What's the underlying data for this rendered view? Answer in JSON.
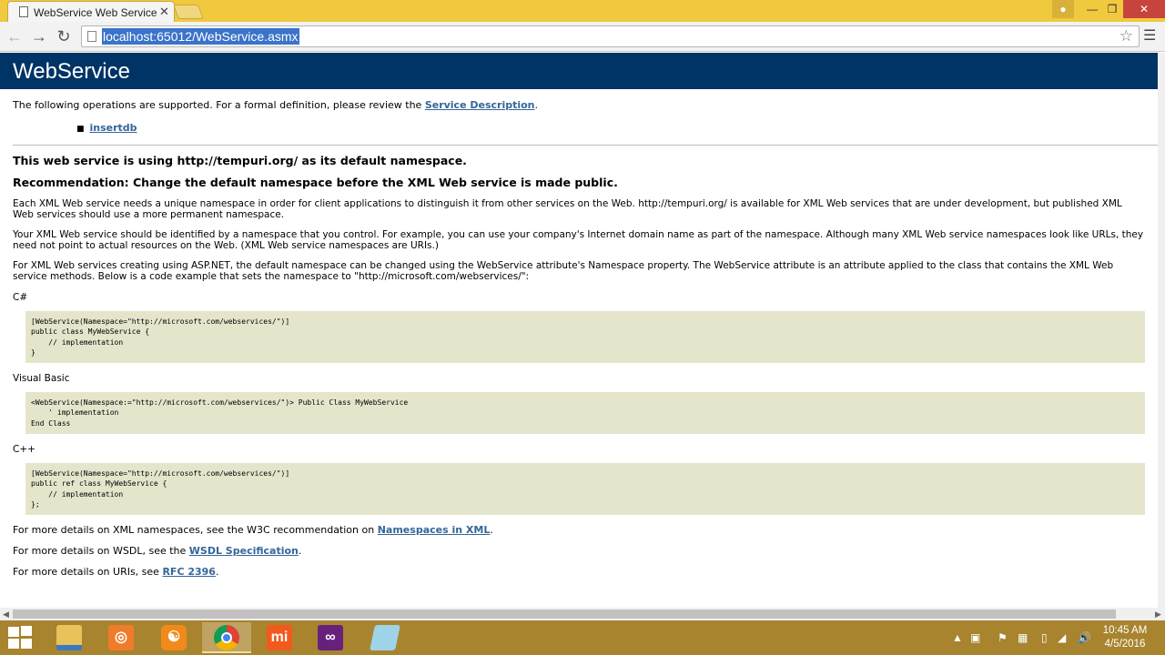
{
  "browser": {
    "tab_title": "WebService Web Service",
    "tab_close": "✕",
    "url": "localhost:65012/WebService.asmx",
    "window_controls": {
      "minimize": "—",
      "maximize": "❐",
      "close": "✕"
    }
  },
  "page": {
    "heading": "WebService",
    "intro_text": "The following operations are supported. For a formal definition, please review the ",
    "intro_link": "Service Description",
    "intro_end": ".",
    "operations": [
      "insertdb"
    ],
    "namespace_notice": "This web service is using http://tempuri.org/ as its default namespace.",
    "recommendation": "Recommendation: Change the default namespace before the XML Web service is made public.",
    "para1": "Each XML Web service needs a unique namespace in order for client applications to distinguish it from other services on the Web. http://tempuri.org/ is available for XML Web services that are under development, but published XML Web services should use a more permanent namespace.",
    "para2": "Your XML Web service should be identified by a namespace that you control. For example, you can use your company's Internet domain name as part of the namespace. Although many XML Web service namespaces look like URLs, they need not point to actual resources on the Web. (XML Web service namespaces are URIs.)",
    "para3": "For XML Web services creating using ASP.NET, the default namespace can be changed using the WebService attribute's Namespace property. The WebService attribute is an attribute applied to the class that contains the XML Web service methods. Below is a code example that sets the namespace to \"http://microsoft.com/webservices/\":",
    "code_samples": [
      {
        "language": "C#",
        "code": "[WebService(Namespace=\"http://microsoft.com/webservices/\")]\npublic class MyWebService {\n    // implementation\n}"
      },
      {
        "language": "Visual Basic",
        "code": "<WebService(Namespace:=\"http://microsoft.com/webservices/\")> Public Class MyWebService\n    ' implementation\nEnd Class"
      },
      {
        "language": "C++",
        "code": "[WebService(Namespace=\"http://microsoft.com/webservices/\")]\npublic ref class MyWebService {\n    // implementation\n};"
      }
    ],
    "more_ns_text": "For more details on XML namespaces, see the W3C recommendation on ",
    "more_ns_link": "Namespaces in XML",
    "more_wsdl_text": "For more details on WSDL, see the ",
    "more_wsdl_link": "WSDL Specification",
    "more_uri_text": "For more details on URIs, see ",
    "more_uri_link": "RFC 2396",
    "period": "."
  },
  "taskbar": {
    "apps": [
      "file-explorer",
      "screen-recorder",
      "uc-browser",
      "chrome",
      "mi",
      "visual-studio",
      "notepad"
    ],
    "mi_label": "mi",
    "time": "10:45 AM",
    "date": "4/5/2016"
  },
  "colors": {
    "header_bg": "#003366",
    "link": "#336699",
    "code_bg": "#e5e5cc",
    "chrome_frame": "#f0c93f",
    "taskbar": "#a8842f"
  }
}
